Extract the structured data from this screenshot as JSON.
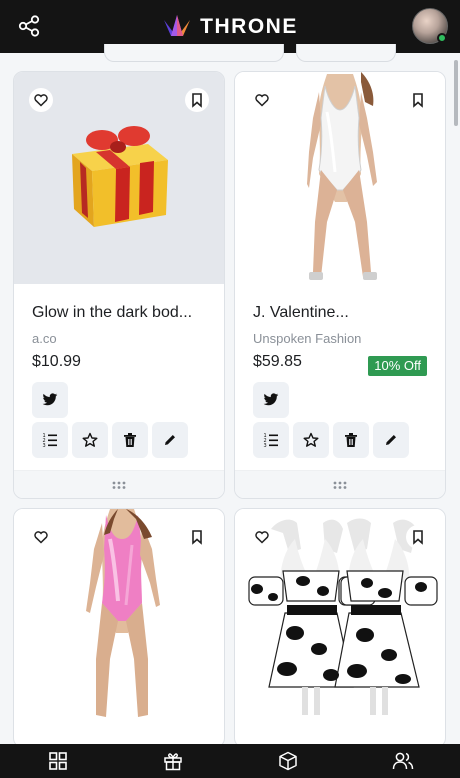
{
  "app": {
    "brand": "THRONE"
  },
  "colors": {
    "topbar": "#141414",
    "accent_badge": "#2f9a52",
    "online": "#2fbd5e",
    "brand_purple": "#7a4cf0",
    "brand_orange": "#f0833a"
  },
  "icons": {
    "share": "share-icon",
    "heart": "heart-icon",
    "bookmark": "bookmark-icon",
    "twitter": "twitter-icon",
    "list": "numbered-list-icon",
    "star": "star-icon",
    "trash": "trash-icon",
    "edit": "pencil-icon",
    "drag": "drag-handle-icon",
    "nav": [
      "grid-icon",
      "gift-icon",
      "box-icon",
      "users-icon"
    ]
  },
  "products": [
    {
      "title": "Glow in the dark bod...",
      "seller": "a.co",
      "price": "$10.99",
      "badge": "",
      "image": "gift-image"
    },
    {
      "title": "J. Valentine...",
      "seller": "Unspoken Fashion",
      "price": "$59.85",
      "badge": "10% Off",
      "image": "white-bodysuit-image"
    },
    {
      "title": "",
      "seller": "",
      "price": "",
      "badge": "",
      "image": "pink-bodysuit-image"
    },
    {
      "title": "",
      "seller": "",
      "price": "",
      "badge": "",
      "image": "cow-print-outfit-image"
    }
  ]
}
